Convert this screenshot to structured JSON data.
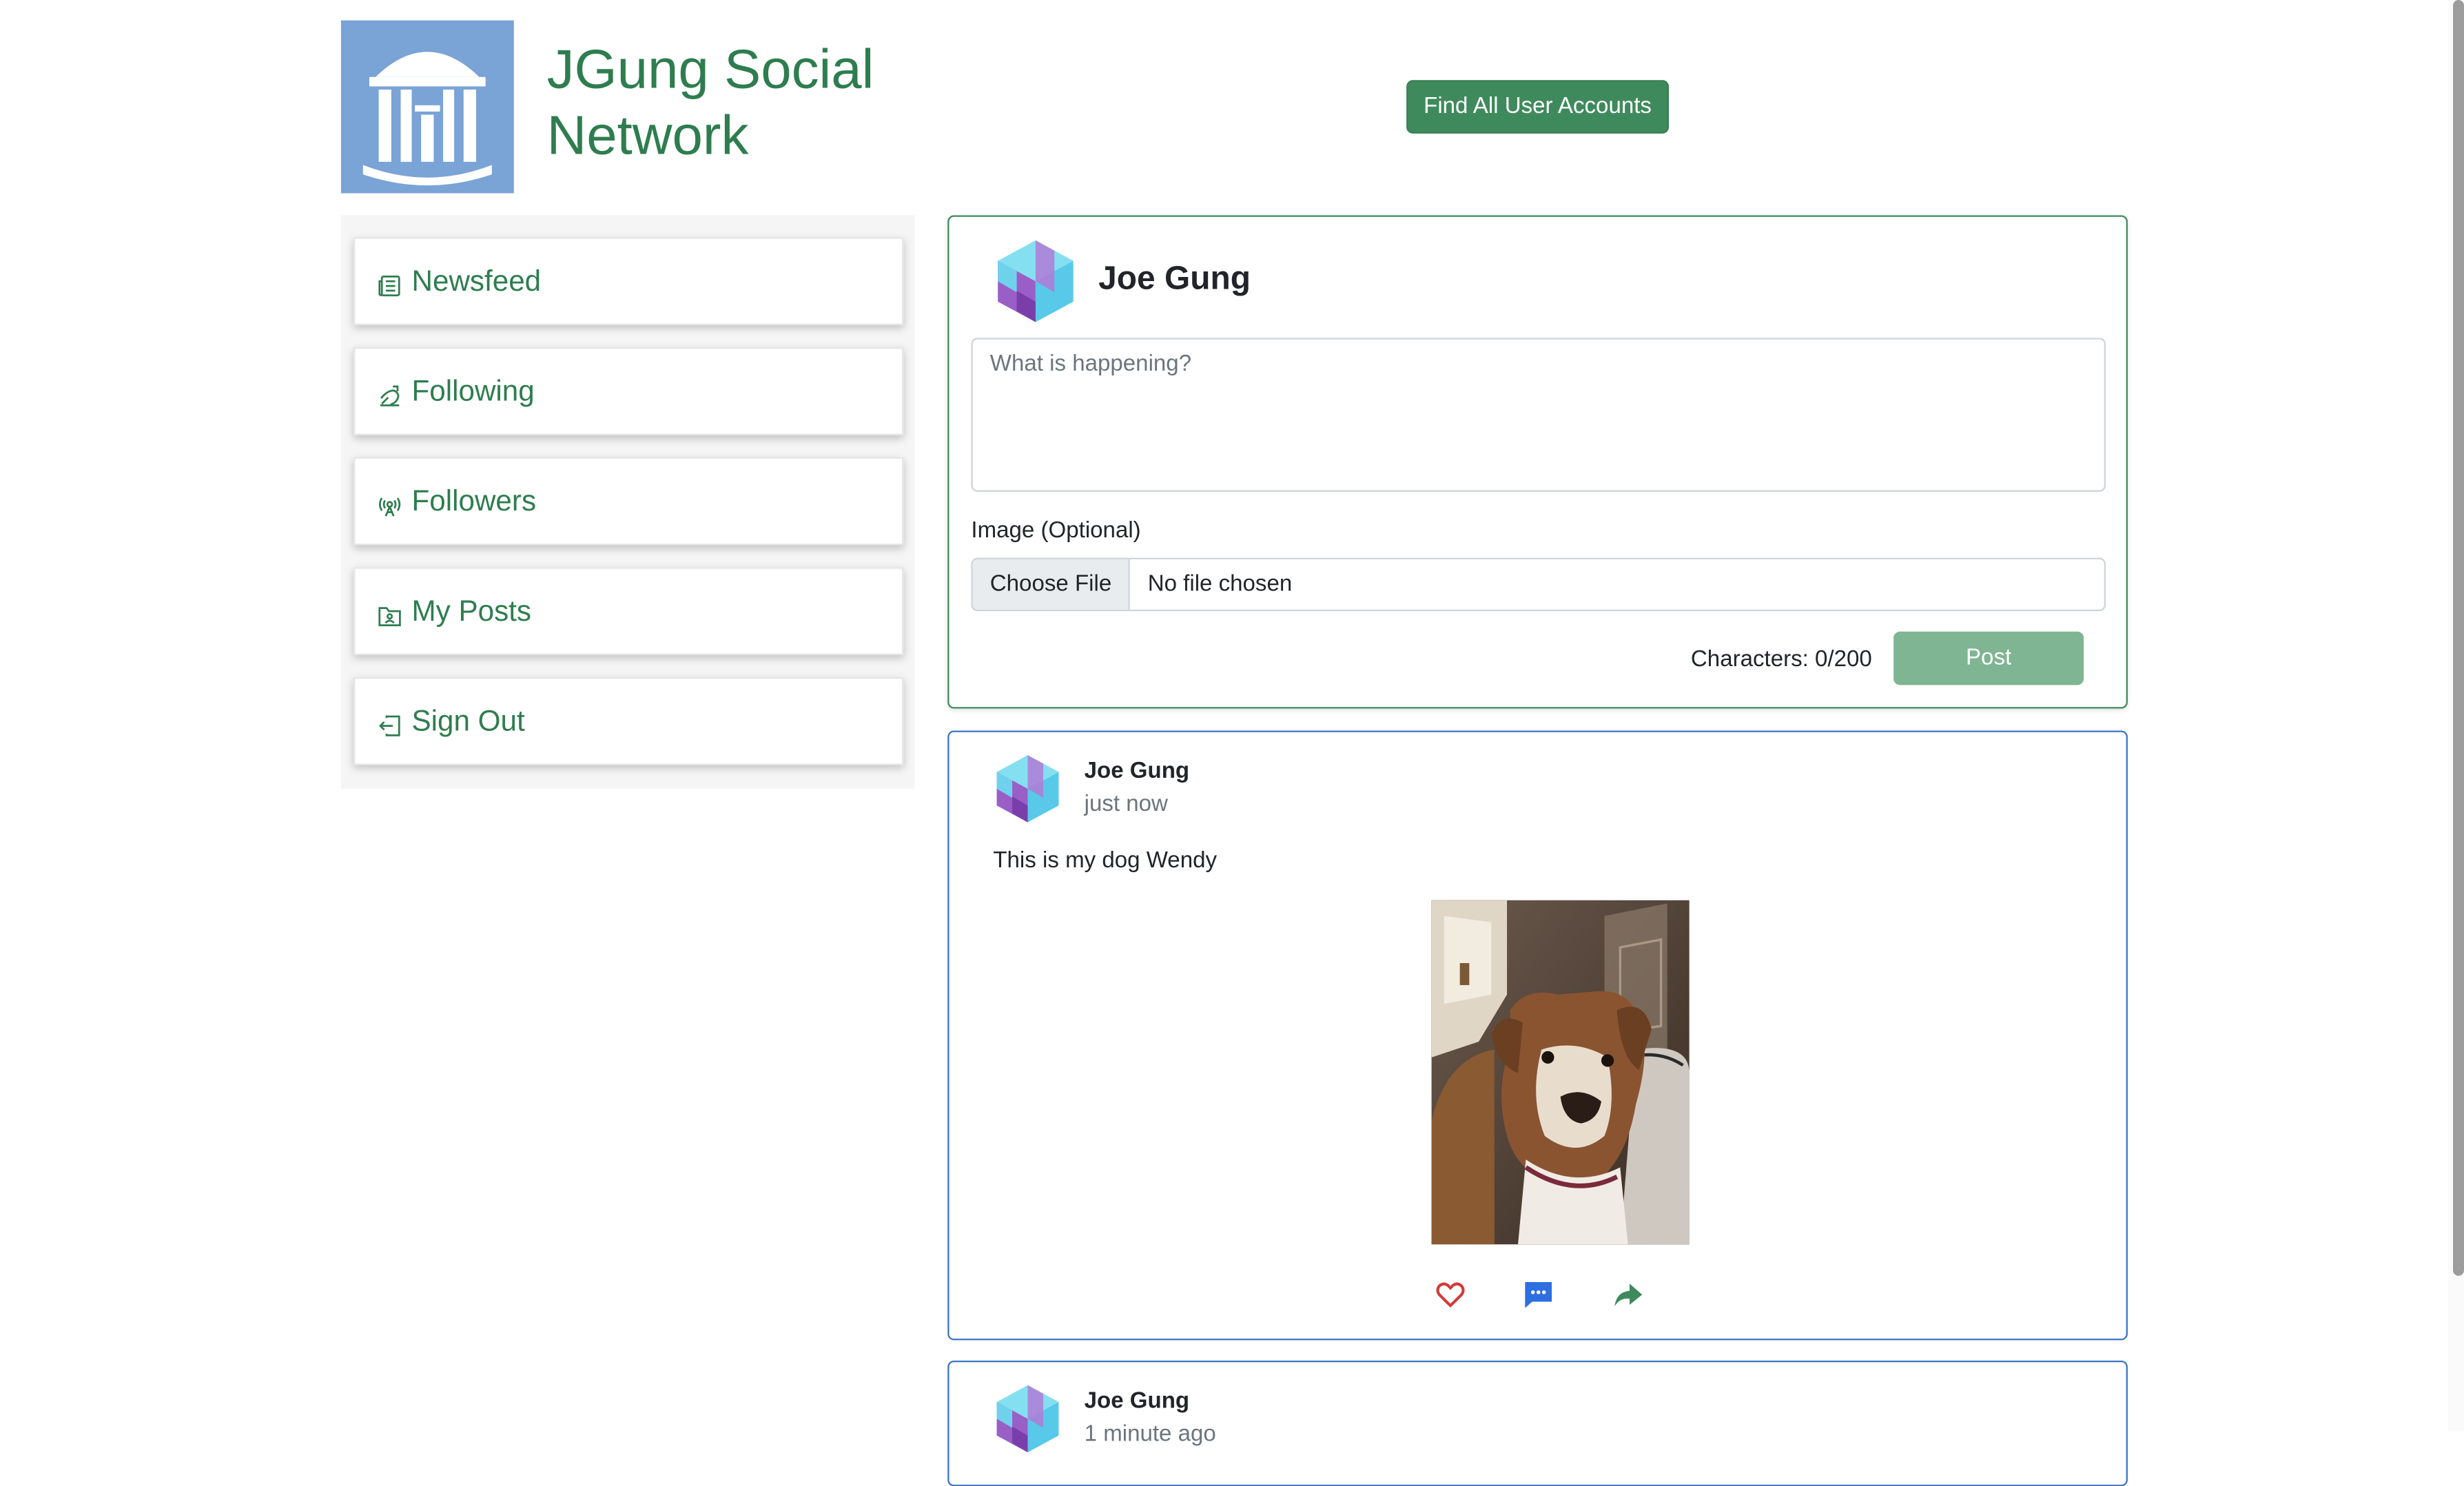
{
  "header": {
    "brand_line1": "JGung Social",
    "brand_line2": "Network",
    "find_button": "Find All User Accounts"
  },
  "sidebar": {
    "items": [
      {
        "label": "Newsfeed",
        "icon": "newspaper-icon"
      },
      {
        "label": "Following",
        "icon": "following-icon"
      },
      {
        "label": "Followers",
        "icon": "broadcast-icon"
      },
      {
        "label": "My Posts",
        "icon": "person-folder-icon"
      },
      {
        "label": "Sign Out",
        "icon": "sign-out-icon"
      }
    ]
  },
  "composer": {
    "user_name": "Joe Gung",
    "placeholder": "What is happening?",
    "image_label": "Image (Optional)",
    "file_button": "Choose File",
    "file_status": "No file chosen",
    "char_count": "Characters: 0/200",
    "post_button": "Post"
  },
  "posts": [
    {
      "author": "Joe Gung",
      "time": "just now",
      "text": "This is my dog Wendy",
      "image": "dog-photo"
    },
    {
      "author": "Joe Gung",
      "time": "1 minute ago"
    }
  ],
  "colors": {
    "brand_green": "#2e7d4f",
    "button_green": "#3f8a5c",
    "post_border": "#3b73c4",
    "like_red": "#d23b3b",
    "comment_blue": "#2d6fe0"
  }
}
